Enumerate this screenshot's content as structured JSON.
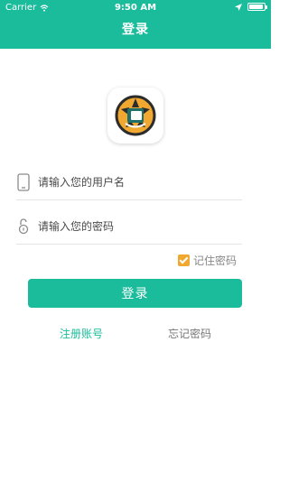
{
  "status_bar": {
    "carrier": "Carrier",
    "time": "9:50 AM",
    "icons": [
      "wifi-icon",
      "location-icon",
      "battery-icon"
    ]
  },
  "nav": {
    "title": "登录"
  },
  "logo": {
    "icon": "app-logo-camera-icon",
    "colors": {
      "ring": "#f0a830",
      "center": "#2c2c2c",
      "accent": "#1bbc9b"
    }
  },
  "form": {
    "username": {
      "placeholder": "请输入您的用户名",
      "value": "",
      "icon": "phone-icon"
    },
    "password": {
      "placeholder": "请输入您的密码",
      "value": "",
      "icon": "lock-icon"
    },
    "remember": {
      "label": "记住密码",
      "checked": true
    }
  },
  "actions": {
    "login": "登录",
    "register": "注册账号",
    "forgot": "忘记密码"
  },
  "theme": {
    "primary": "#1bbc9b",
    "checkbox": "#f0a830"
  }
}
